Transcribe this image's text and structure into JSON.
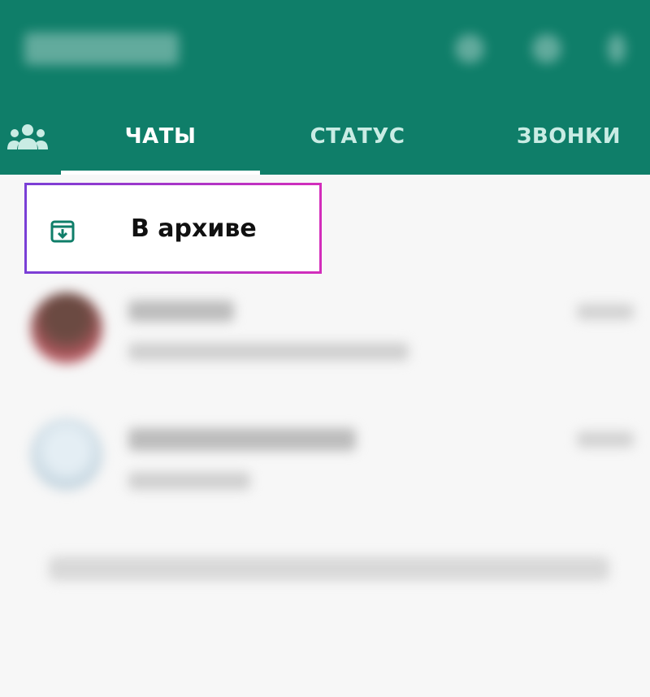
{
  "tabs": {
    "items": [
      {
        "label": "ЧАТЫ",
        "active": true
      },
      {
        "label": "СТАТУС",
        "active": false
      },
      {
        "label": "ЗВОНКИ",
        "active": false
      }
    ]
  },
  "archive": {
    "label": "В архиве",
    "icon": "archive-icon"
  },
  "icons": {
    "community": "community-icon",
    "search": "search-icon",
    "camera": "camera-icon",
    "menu": "more-icon"
  },
  "colors": {
    "appbar": "#0f7e69",
    "highlight_start": "#7a3fd6",
    "highlight_end": "#d32dbb",
    "archive_icon": "#0f7e69"
  }
}
